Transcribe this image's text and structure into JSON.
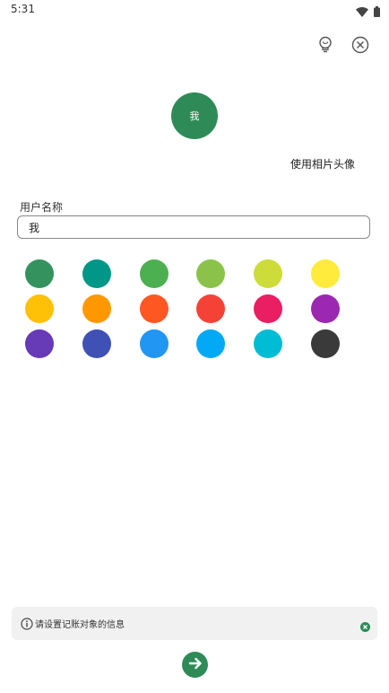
{
  "status_bar": {
    "time": "5:31",
    "wifi_icon": "wifi-icon",
    "battery_icon": "battery-icon"
  },
  "header": {
    "tip_icon": "lightbulb-icon",
    "close_icon": "close-circle-icon"
  },
  "avatar": {
    "text": "我",
    "color": "#2e8b57"
  },
  "use_photo_label": "使用相片头像",
  "name_field": {
    "label": "用户名称",
    "value": "我"
  },
  "colors": [
    "#34925f",
    "#009688",
    "#4caf50",
    "#8bc34a",
    "#cddc39",
    "#ffeb3b",
    "#ffc107",
    "#ff9800",
    "#ff5722",
    "#f44336",
    "#e91e63",
    "#9c27b0",
    "#673ab7",
    "#3f51b5",
    "#2196f3",
    "#03a9f4",
    "#00bcd4",
    "#3a3a3a"
  ],
  "hint": {
    "info_icon": "info-icon",
    "text": "请设置记账对象的信息",
    "close_icon": "close-small-icon",
    "close_color": "#2e8b57"
  },
  "next_button": {
    "icon": "arrow-right-icon",
    "color": "#2e8b57"
  }
}
